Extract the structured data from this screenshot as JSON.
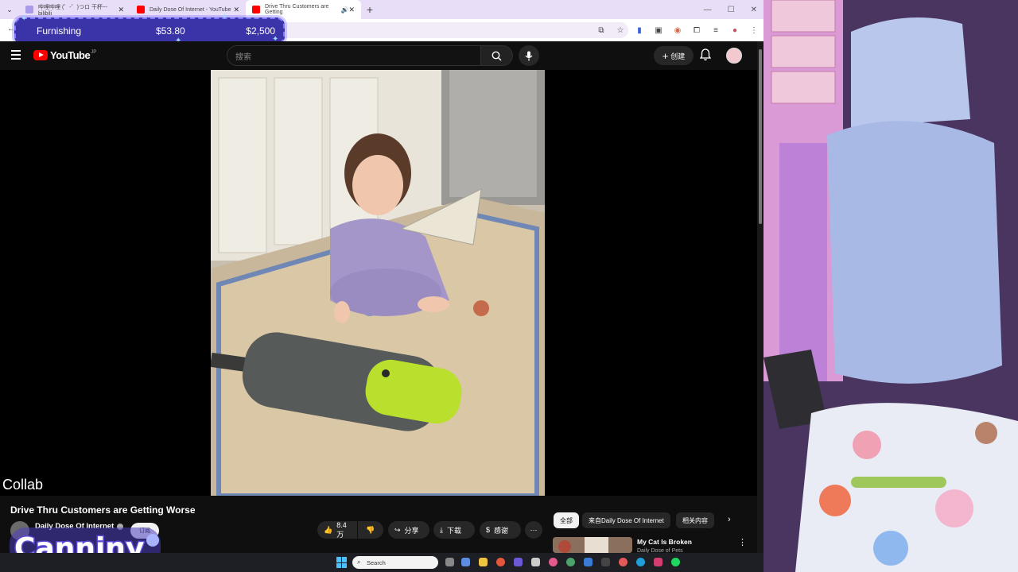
{
  "browser": {
    "tabs": [
      {
        "title": "哔哩哔哩 (゜-゜)つロ 干杯~-bilibili",
        "active": false
      },
      {
        "title": "Daily Dose Of Internet - YouTube",
        "active": false
      },
      {
        "title": "Drive Thru Customers are Getting",
        "active": true
      }
    ],
    "new_tab": "+"
  },
  "furnishing_overlay": {
    "label": "Furnishing",
    "price": "$53.80",
    "goal": "$2,500"
  },
  "youtube": {
    "logo_text": "YouTube",
    "region": "JP",
    "search_placeholder": "搜索",
    "create_label": "创建"
  },
  "video": {
    "title": "Drive Thru Customers are Getting Worse",
    "overlay_text": "Collab",
    "channel_name": "Daily Dose Of Internet",
    "subscribe_label": "订阅",
    "like_count": "8.4万",
    "share_label": "分享",
    "download_label": "下载",
    "thanks_label": "感谢"
  },
  "chips": {
    "all": "全部",
    "from_channel": "来自Daily Dose Of Internet",
    "related": "相关内容"
  },
  "recommendation": {
    "title": "My Cat Is Broken",
    "channel": "Daily Dose of Pets"
  },
  "streamer_overlay": {
    "name": "Canniny"
  },
  "taskbar": {
    "search_label": "Search"
  },
  "colors": {
    "youtube_red": "#ff0000",
    "overlay_purple": "#3b34a8",
    "tabstrip": "#e8def8"
  }
}
